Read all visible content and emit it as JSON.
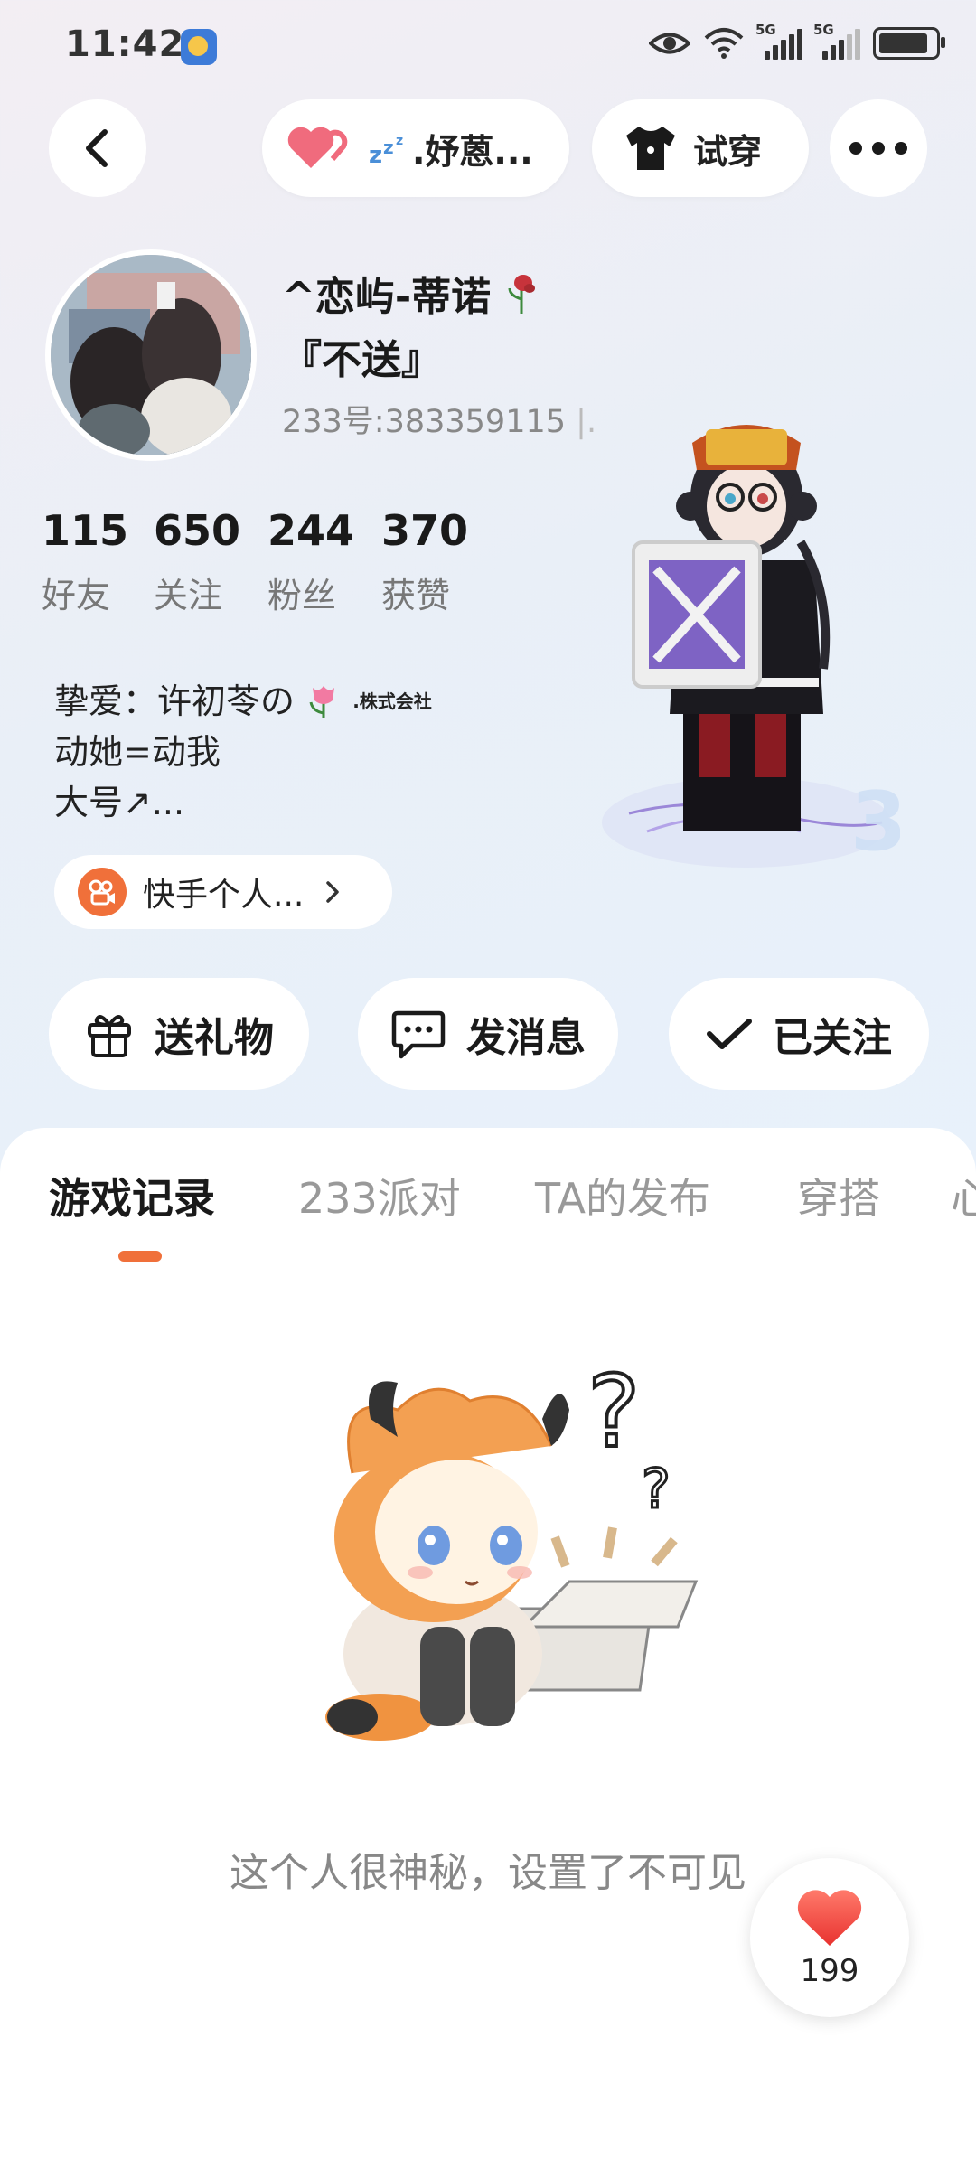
{
  "status_bar": {
    "time": "11:42",
    "network_labels": [
      "5G",
      "5G"
    ],
    "battery_level": 0.95
  },
  "header": {
    "mood_label": ".妤蒽...",
    "tryon_label": "试穿"
  },
  "profile": {
    "nickname": "^恋屿-蒂诺",
    "nickname_line2": "『不送』",
    "uid": "233号:383359115",
    "uid_suffix": "|.",
    "stats": [
      {
        "value": "115",
        "label": "好友"
      },
      {
        "value": "650",
        "label": "关注"
      },
      {
        "value": "244",
        "label": "粉丝"
      },
      {
        "value": "370",
        "label": "获赞"
      }
    ],
    "bio_lines": [
      "挚爱：许初苓の",
      "动她=动我",
      "大号↗..."
    ],
    "bio_badge": ".株式会社",
    "kuaishou_link": "快手个人..."
  },
  "actions": {
    "gift": "送礼物",
    "message": "发消息",
    "follow": "已关注"
  },
  "tabs": [
    "游戏记录",
    "233派对",
    "TA的发布",
    "穿搭",
    "心"
  ],
  "empty_state": {
    "message": "这个人很神秘，设置了不可见"
  },
  "like": {
    "count": "199"
  },
  "colors": {
    "accent": "#f0703a",
    "like_red": "#f0474a"
  }
}
